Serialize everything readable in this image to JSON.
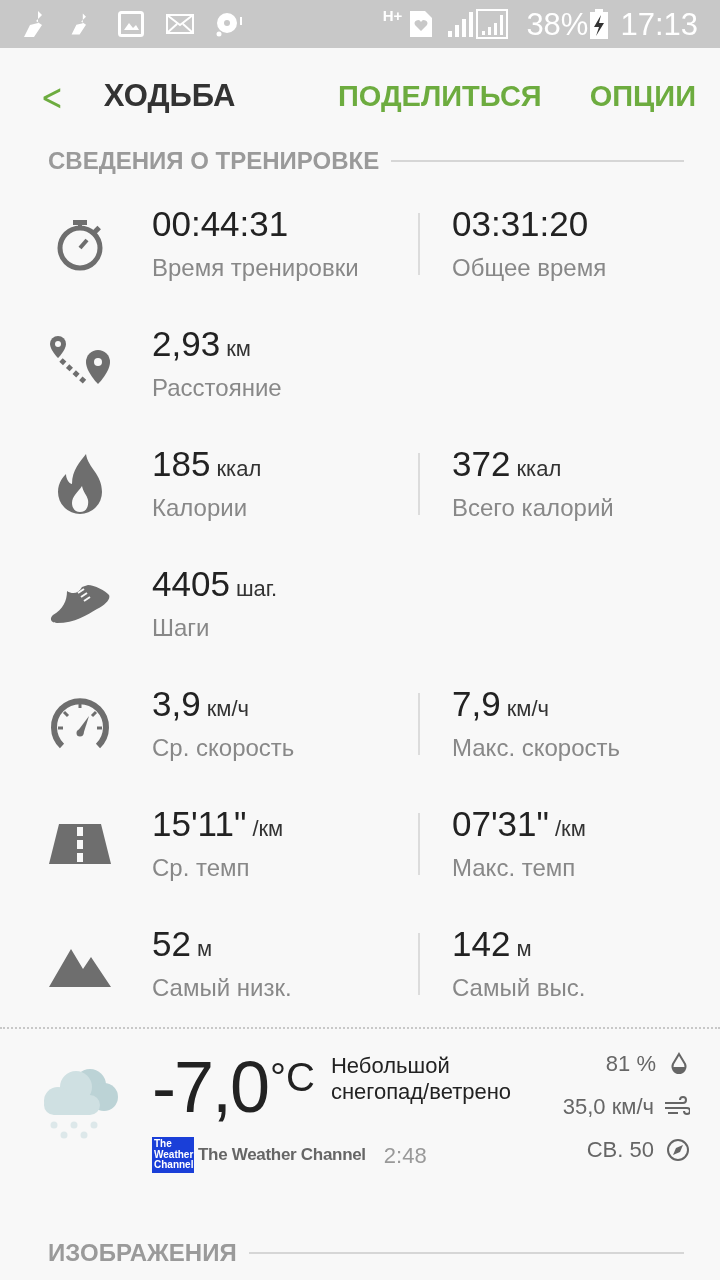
{
  "status_bar": {
    "battery": "38%",
    "time": "17:13",
    "network": "H+"
  },
  "header": {
    "back": "<",
    "title": "ХОДЬБА",
    "actions": [
      "ПОДЕЛИТЬСЯ",
      "ОПЦИИ"
    ]
  },
  "section_title": "СВЕДЕНИЯ О ТРЕНИРОВКЕ",
  "rows": [
    {
      "kind": "stopwatch",
      "stats": [
        {
          "value": "00:44:31",
          "label": "Время тренировки"
        },
        {
          "value": "03:31:20",
          "label": "Общее время"
        }
      ]
    },
    {
      "kind": "route",
      "stats": [
        {
          "value": "2,93",
          "unit": "км",
          "label": "Расстояние"
        }
      ]
    },
    {
      "kind": "flame",
      "stats": [
        {
          "value": "185",
          "unit": "ккал",
          "label": "Калории"
        },
        {
          "value": "372",
          "unit": "ккал",
          "label": "Всего калорий"
        }
      ]
    },
    {
      "kind": "shoe",
      "stats": [
        {
          "value": "4405",
          "unit": "шаг.",
          "label": "Шаги"
        }
      ]
    },
    {
      "kind": "speedometer",
      "stats": [
        {
          "value": "3,9",
          "unit": "км/ч",
          "label": "Ср. скорость"
        },
        {
          "value": "7,9",
          "unit": "км/ч",
          "label": "Макс. скорость"
        }
      ]
    },
    {
      "kind": "road",
      "stats": [
        {
          "value": "15'11\"",
          "unit": "/км",
          "label": "Ср. темп"
        },
        {
          "value": "07'31\"",
          "unit": "/км",
          "label": "Макс. темп"
        }
      ]
    },
    {
      "kind": "mountain",
      "stats": [
        {
          "value": "52",
          "unit": "м",
          "label": "Самый низк."
        },
        {
          "value": "142",
          "unit": "м",
          "label": "Самый выс."
        }
      ]
    }
  ],
  "weather": {
    "temperature": "-7,0",
    "unit": "°C",
    "condition": "Небольшой снегопад/ветрено",
    "provider": "The Weather Channel",
    "provider_logo": [
      "The",
      "Weather",
      "Channel"
    ],
    "time": "2:48",
    "humidity": "81 %",
    "wind_speed": "35,0 км/ч",
    "wind_direction": "СВ. 50"
  },
  "images_title": "ИЗОБРАЖЕНИЯ"
}
